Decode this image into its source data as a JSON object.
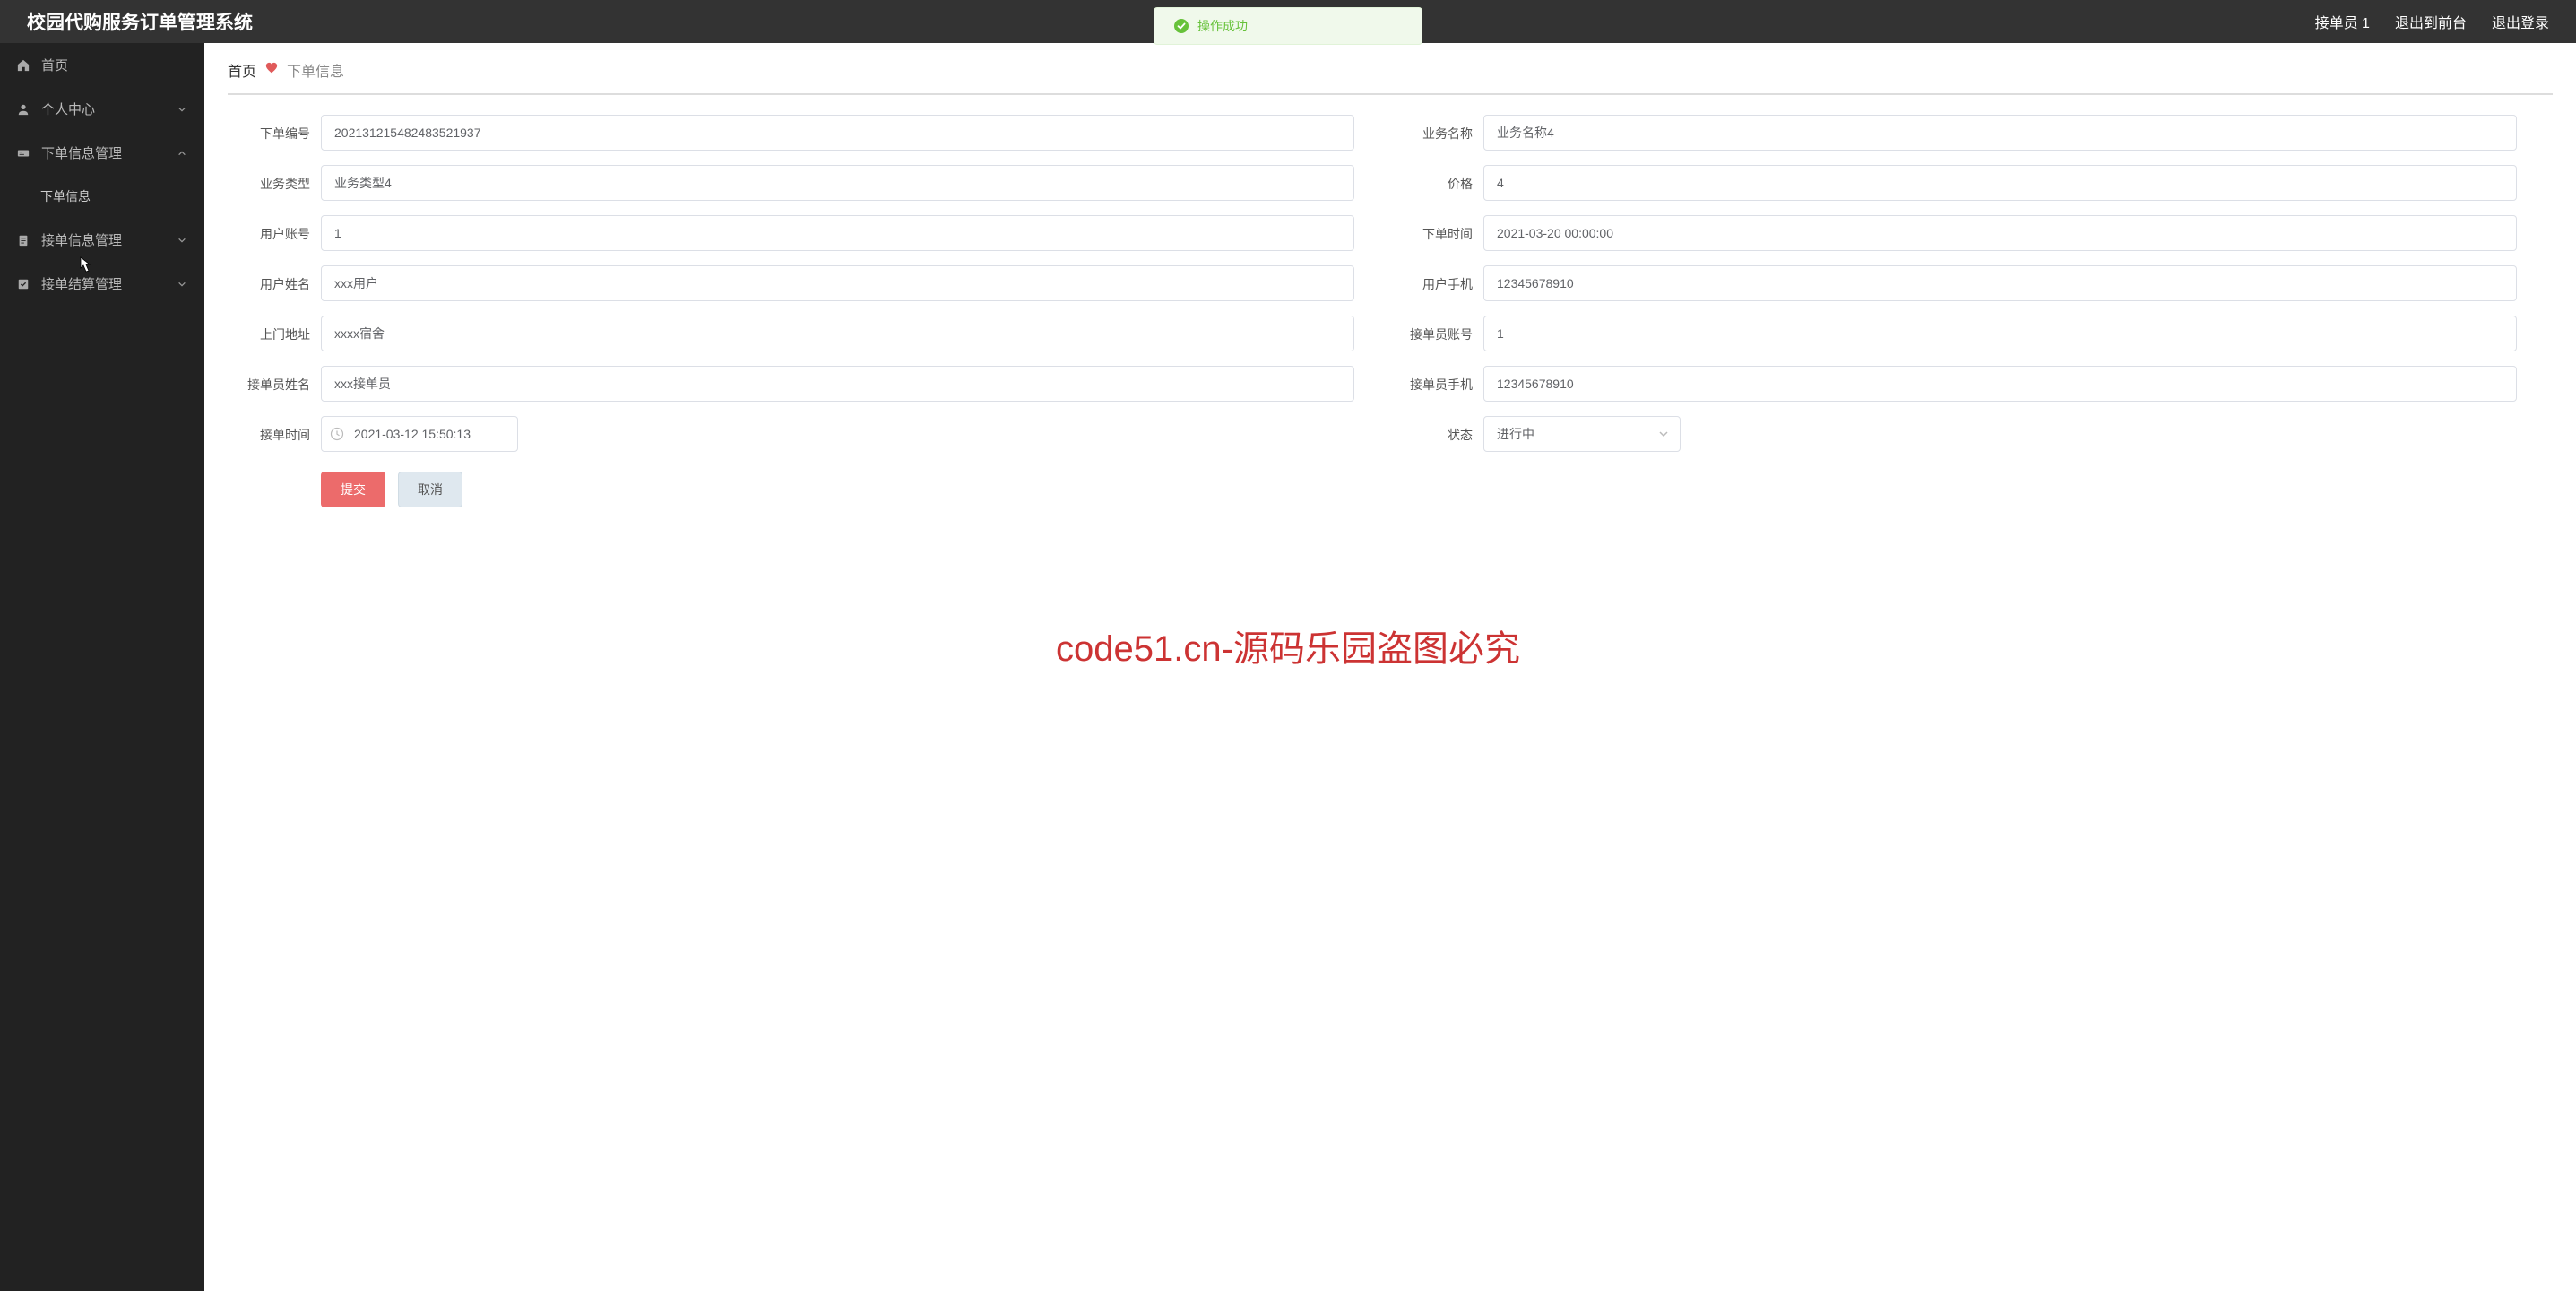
{
  "header": {
    "title": "校园代购服务订单管理系统",
    "userRole": "接单员 1",
    "logoutFront": "退出到前台",
    "logout": "退出登录"
  },
  "toast": {
    "text": "操作成功"
  },
  "sidebar": {
    "items": [
      {
        "key": "home",
        "label": "首页"
      },
      {
        "key": "personal",
        "label": "个人中心"
      },
      {
        "key": "orderinfo",
        "label": "下单信息管理"
      },
      {
        "key": "orderinfo-sub",
        "label": "下单信息"
      },
      {
        "key": "accept",
        "label": "接单信息管理"
      },
      {
        "key": "settle",
        "label": "接单结算管理"
      }
    ]
  },
  "breadcrumb": {
    "home": "首页",
    "current": "下单信息"
  },
  "form": {
    "orderNoLabel": "下单编号",
    "orderNoValue": "202131215482483521937",
    "bizNameLabel": "业务名称",
    "bizNameValue": "业务名称4",
    "bizTypeLabel": "业务类型",
    "bizTypeValue": "业务类型4",
    "priceLabel": "价格",
    "priceValue": "4",
    "userAcctLabel": "用户账号",
    "userAcctValue": "1",
    "orderTimeLabel": "下单时间",
    "orderTimeValue": "2021-03-20 00:00:00",
    "userNameLabel": "用户姓名",
    "userNameValue": "xxx用户",
    "userPhoneLabel": "用户手机",
    "userPhoneValue": "12345678910",
    "addrLabel": "上门地址",
    "addrValue": "xxxx宿舍",
    "acceptAcctLabel": "接单员账号",
    "acceptAcctValue": "1",
    "acceptNameLabel": "接单员姓名",
    "acceptNameValue": "xxx接单员",
    "acceptPhoneLabel": "接单员手机",
    "acceptPhoneValue": "12345678910",
    "acceptTimeLabel": "接单时间",
    "acceptTimeValue": "2021-03-12 15:50:13",
    "statusLabel": "状态",
    "statusValue": "进行中"
  },
  "buttons": {
    "submit": "提交",
    "cancel": "取消"
  },
  "watermark": {
    "text": "code51.cn",
    "center": "code51.cn-源码乐园盗图必究"
  }
}
